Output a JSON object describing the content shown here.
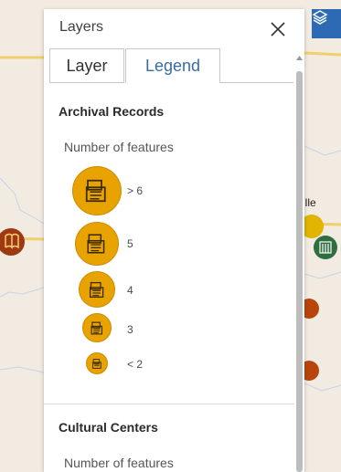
{
  "panel": {
    "title": "Layers",
    "tabs": [
      {
        "label": "Layer",
        "active": false
      },
      {
        "label": "Legend",
        "active": true
      }
    ]
  },
  "legend": {
    "sections": [
      {
        "title": "Archival Records",
        "subtitle": "Number of features",
        "symbol_color": "#e8a300",
        "classes": [
          {
            "label": "> 6"
          },
          {
            "label": "5"
          },
          {
            "label": "4"
          },
          {
            "label": "3"
          },
          {
            "label": "< 2"
          }
        ]
      },
      {
        "title": "Cultural Centers",
        "subtitle": "Number of features"
      }
    ]
  },
  "map": {
    "visible_label": "ille",
    "marker_colors": {
      "brown": "#9e3a12",
      "orange": "#b9440c",
      "green": "#2f6e3e",
      "yellow": "#e0b400"
    }
  },
  "colors": {
    "accent": "#3b6c9e",
    "fab": "#2d6ab3"
  }
}
